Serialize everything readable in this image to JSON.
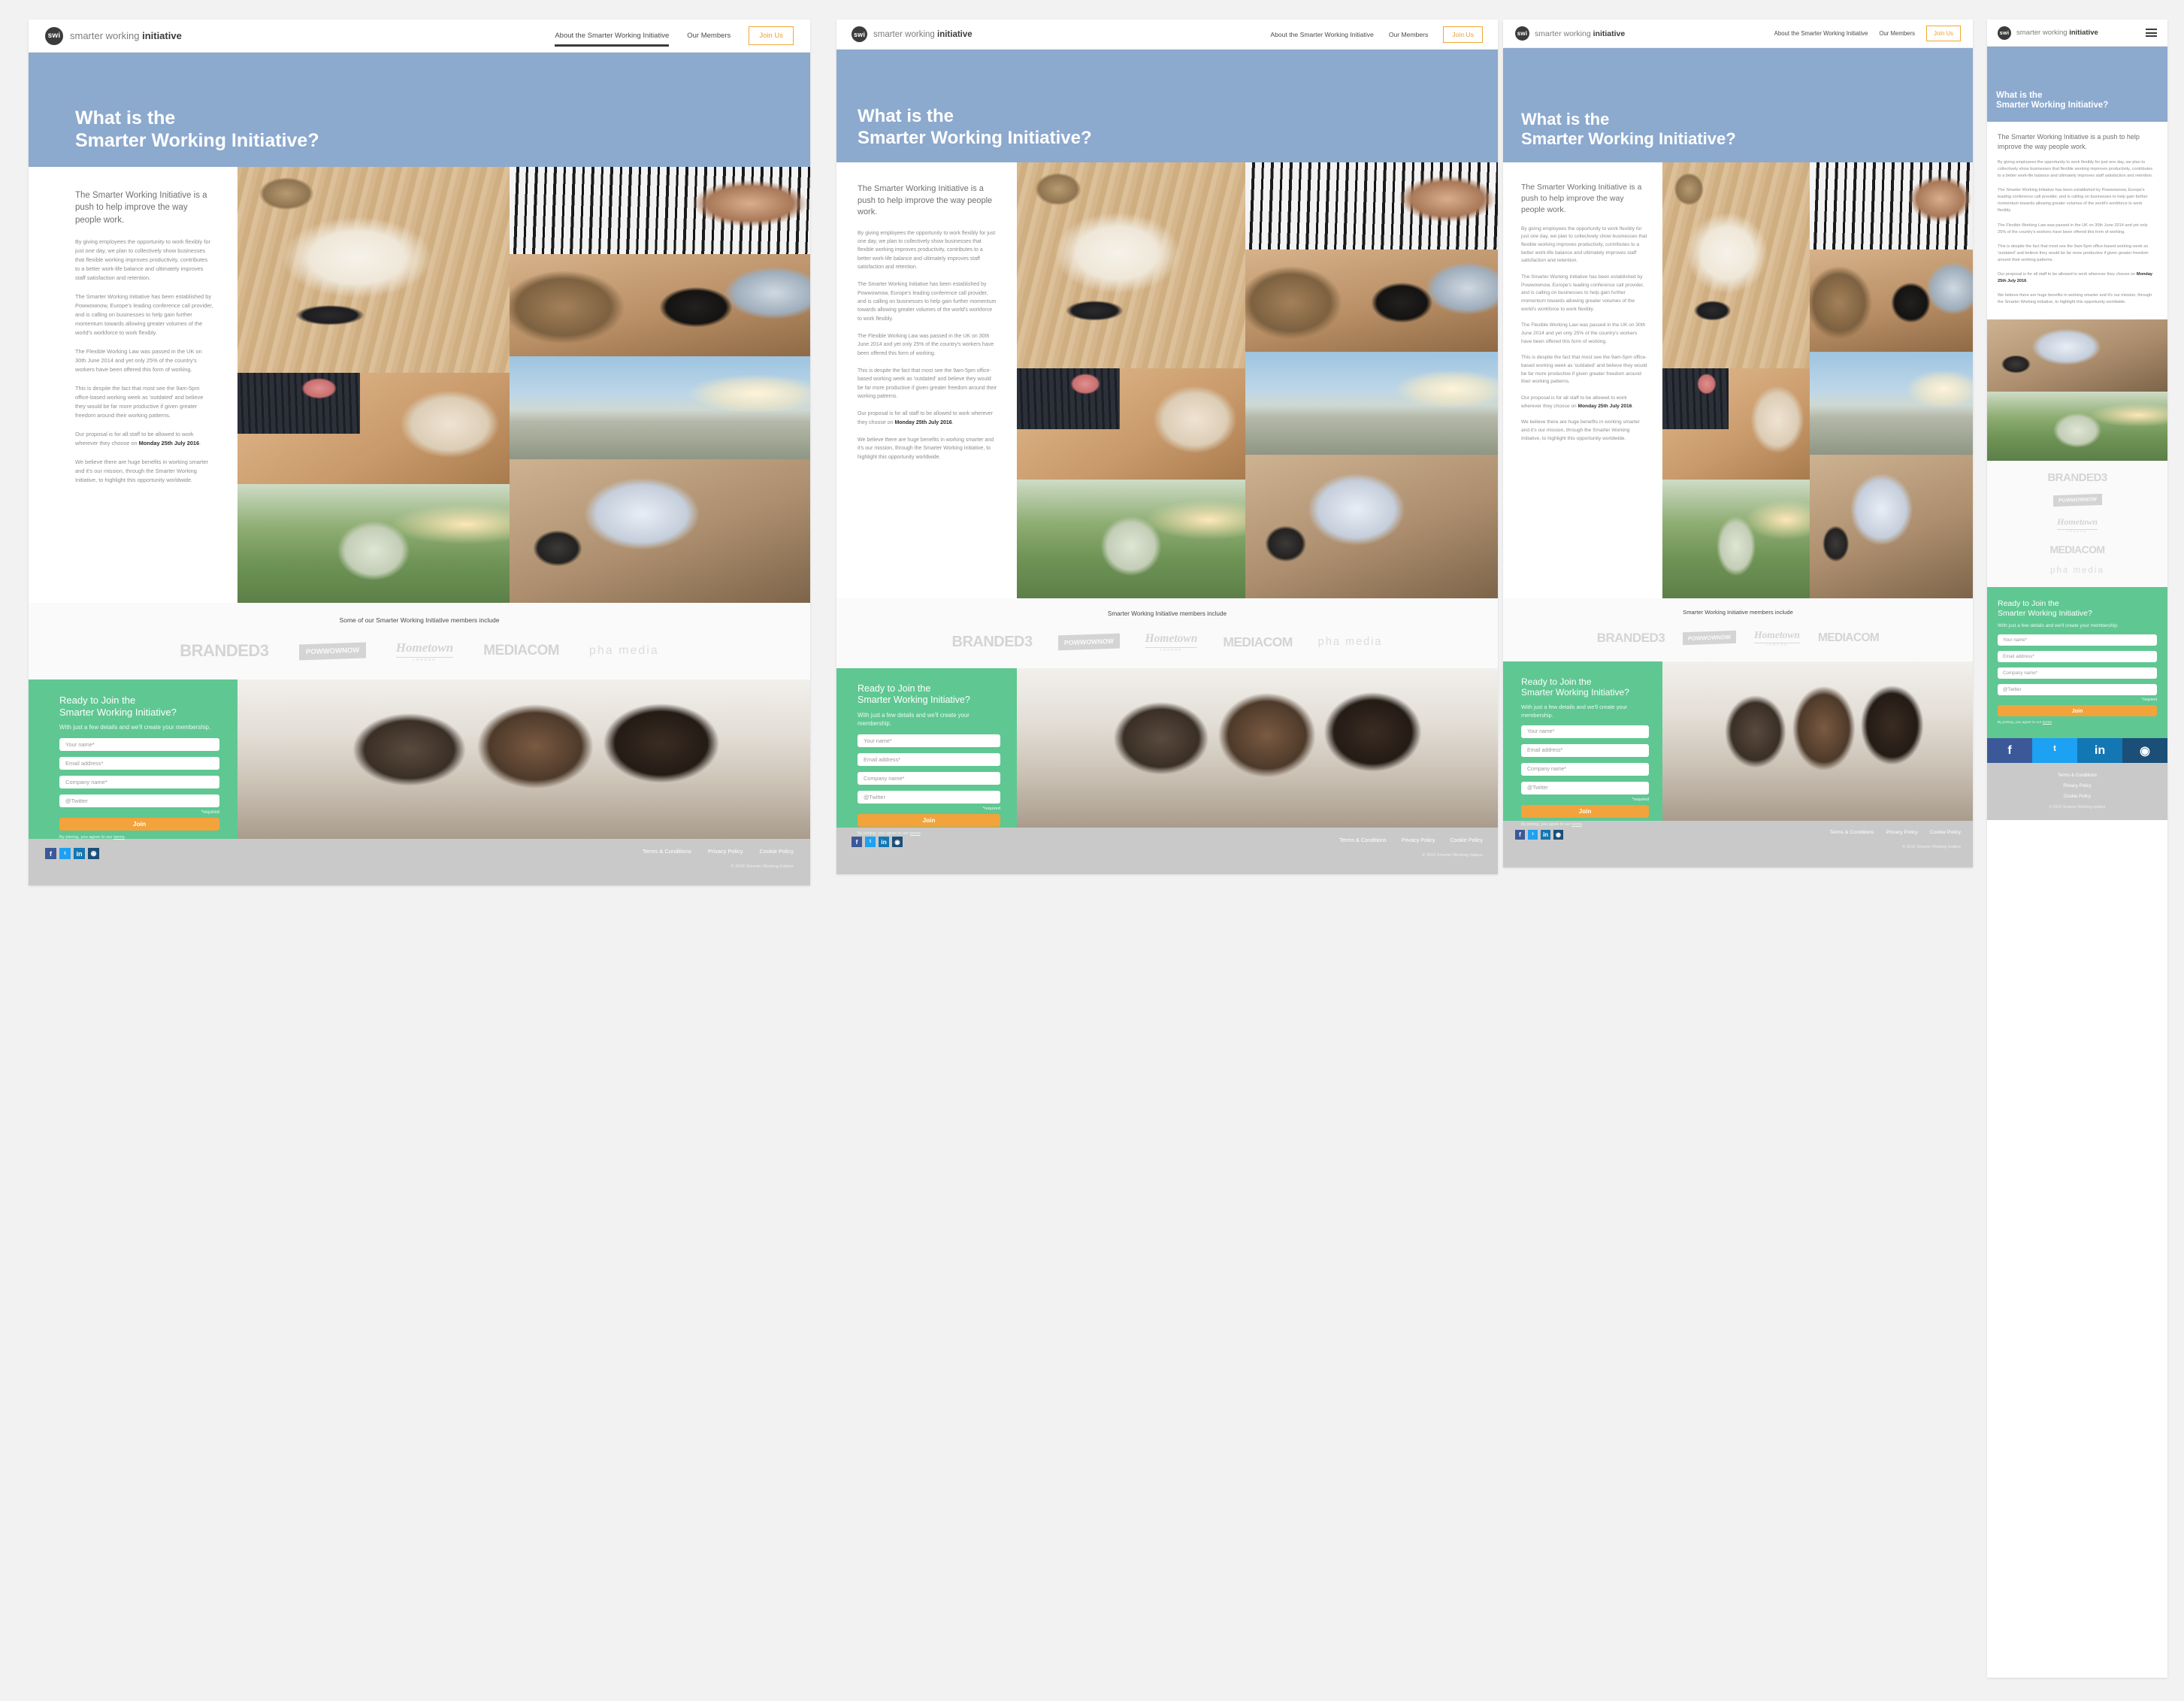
{
  "brand": {
    "badge": "swi",
    "name_light": "smarter working ",
    "name_bold": "initiative"
  },
  "nav": {
    "about": "About the Smarter Working Initiative",
    "members": "Our Members",
    "join": "Join Us",
    "menu_icon": "hamburger-menu-icon"
  },
  "hero": {
    "line1": "What is the",
    "line2": "Smarter Working Initiative?"
  },
  "copy": {
    "lead": "The Smarter Working Initiative is a push to help improve the way people work.",
    "p1": "By giving employees the opportunity to work flexibly for just one day, we plan to collectively show businesses that flexible working improves productivity, contributes to a better work-life balance and ultimately improves staff satisfaction and retention.",
    "p2": "The Smarter Working Initiative has been established by Powwownow, Europe's leading conference call provider, and is calling on businesses to help gain further momentum towards allowing greater volumes of the world's workforce to work flexibly.",
    "p3": "The Flexible Working Law was passed in the UK on 30th June 2014 and yet only 25% of the country's workers have been offered this form of working.",
    "p4": "This is despite the fact that most see the 9am-5pm office-based working week as 'outdated' and believe they would be far more productive if given greater freedom around their working patterns.",
    "p5_before": "Our proposal is for all staff to be allowed to work wherever they choose on ",
    "p5_bold": "Monday 25th July 2016",
    "p5_after": ".",
    "p6": "We believe there are huge benefits in working smarter and it's our mission, through the Smarter Working Initiative, to highlight this opportunity worldwide."
  },
  "collage": {
    "images": [
      "notebook-phone-desk-photo",
      "piano-hands-photo",
      "woman-coffee-laptop-photo",
      "laptop-typing-soda-photo",
      "beach-surfboard-sunset-photo",
      "boy-field-bunting-photo",
      "desk-laptop-mug-photo"
    ]
  },
  "members": {
    "title_long": "Some of our Smarter Working Initiative members include",
    "title_short": "Smarter Working Initiative members include",
    "logos": [
      {
        "name": "BRANDED3",
        "key": "branded3"
      },
      {
        "name": "POWWOWNOW",
        "key": "pww"
      },
      {
        "name": "Hometown",
        "sub": "LONDON",
        "key": "hometown"
      },
      {
        "name": "MEDIACOM",
        "key": "mediacom"
      },
      {
        "name": "pha media",
        "key": "pha"
      }
    ]
  },
  "cta": {
    "title_line1": "Ready to Join the",
    "title_line2": "Smarter Working Initiative?",
    "subtitle": "With just a few details and we'll create your membership.",
    "fields": [
      {
        "placeholder": "Your name*",
        "name": "your-name-input"
      },
      {
        "placeholder": "Email address*",
        "name": "email-address-input"
      },
      {
        "placeholder": "Company name*",
        "name": "company-name-input"
      },
      {
        "placeholder": "@Twitter",
        "name": "twitter-handle-input"
      }
    ],
    "required_note": "*required",
    "join_button": "Join",
    "terms_before": "By joining, you agree to our ",
    "terms_link": "terms",
    "terms_after": ".",
    "photo": "conference-audience-photo"
  },
  "footer": {
    "socials": [
      {
        "label": "f",
        "name": "facebook-icon",
        "key": "fb"
      },
      {
        "label": "ᵗ",
        "name": "twitter-icon",
        "key": "tw"
      },
      {
        "label": "in",
        "name": "linkedin-icon",
        "key": "li"
      },
      {
        "label": "◉",
        "name": "instagram-icon",
        "key": "ig"
      }
    ],
    "links": [
      "Terms & Conditions",
      "Privacy Policy",
      "Cookie Policy"
    ],
    "copyright": "© 2016 Smarter Working Iniative"
  },
  "colors": {
    "hero_blue": "#8ca9ce",
    "cta_green": "#5fc792",
    "join_orange": "#f2a33c",
    "nav_accent": "#eba02c",
    "footer_grey": "#c9c9c9"
  }
}
